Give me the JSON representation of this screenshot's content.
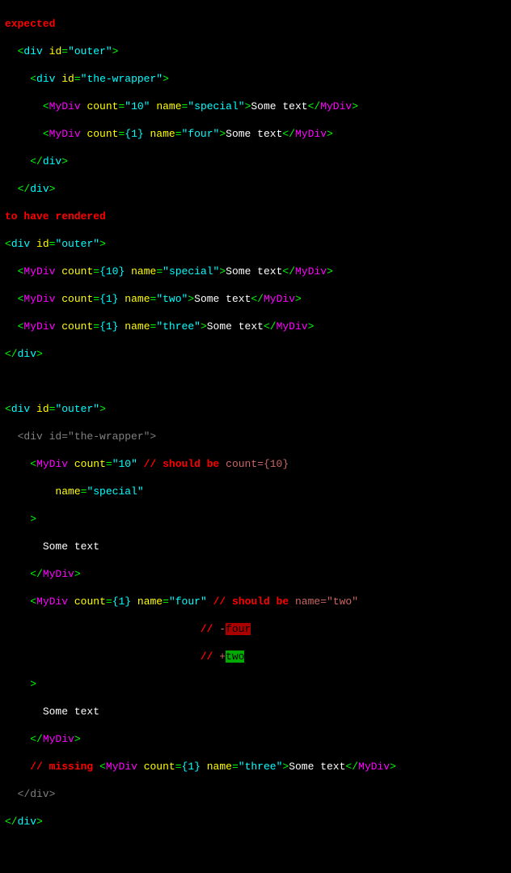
{
  "hdr": {
    "expected": "expected",
    "rendered": "to have rendered"
  },
  "txt": {
    "some": "Some text"
  },
  "tags": {
    "div": "div",
    "mydiv": "MyDiv"
  },
  "attr": {
    "id": "id",
    "count": "count",
    "name": "name"
  },
  "val": {
    "outer": "\"outer\"",
    "wrapper": "\"the-wrapper\"",
    "ten_s": "\"10\"",
    "ten_e": "{10}",
    "one_e": "{1}",
    "special": "\"special\"",
    "four": "\"four\"",
    "two": "\"two\"",
    "three": "\"three\""
  },
  "diff": {
    "c1": "// ",
    "sb": "should be",
    "count10": " count={10}",
    "nameTwo": " name=\"two\"",
    "minus": "-",
    "plus": "+",
    "four": "four",
    "two": "two",
    "missing": "// missing "
  }
}
